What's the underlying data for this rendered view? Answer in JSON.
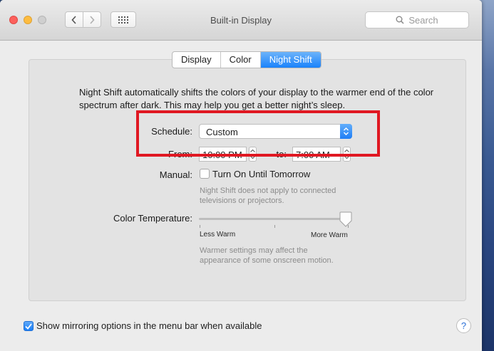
{
  "window": {
    "title": "Built-in Display"
  },
  "toolbar": {
    "search_placeholder": "Search"
  },
  "tabs": [
    {
      "label": "Display",
      "active": false
    },
    {
      "label": "Color",
      "active": false
    },
    {
      "label": "Night Shift",
      "active": true
    }
  ],
  "night_shift": {
    "description": "Night Shift automatically shifts the colors of your display to the warmer end of the color spectrum after dark. This may help you get a better night’s sleep.",
    "schedule": {
      "label": "Schedule:",
      "value": "Custom"
    },
    "from": {
      "label": "From:",
      "value": "10:00 PM"
    },
    "to": {
      "label": "to:",
      "value": "7:00 AM"
    },
    "manual": {
      "label": "Manual:",
      "checkbox_label": "Turn On Until Tomorrow",
      "checked": false,
      "note": [
        "Night Shift does not apply to connected",
        "televisions or projectors."
      ]
    },
    "color_temperature": {
      "label": "Color Temperature:",
      "min_label": "Less Warm",
      "max_label": "More Warm",
      "level": 1.0,
      "note": [
        "Warmer settings may affect the",
        "appearance of some onscreen motion."
      ]
    }
  },
  "footer": {
    "mirroring_label": "Show mirroring options in the menu bar when available",
    "mirroring_checked": true,
    "help_label": "?"
  },
  "colors": {
    "accent": "#1a82fb",
    "highlight": "#e01822"
  }
}
